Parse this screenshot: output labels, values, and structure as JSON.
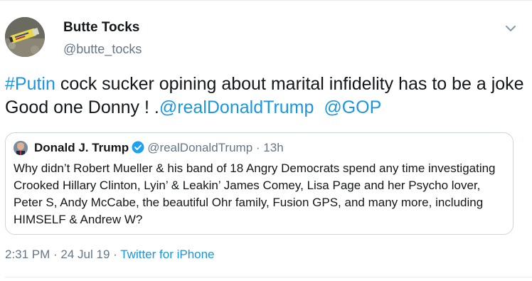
{
  "author": {
    "display_name": "Butte Tocks",
    "handle": "@butte_tocks"
  },
  "tweet": {
    "segments": [
      {
        "text": "#Putin",
        "link": true
      },
      {
        "text": " cock sucker opining about marital infidelity has to be a joke Good one Donny ! .",
        "link": false
      },
      {
        "text": "@realDonaldTrump",
        "link": true
      },
      {
        "text": "  ",
        "link": false
      },
      {
        "text": "@GOP",
        "link": true
      }
    ]
  },
  "quoted_tweet": {
    "name": "Donald J. Trump",
    "verified": true,
    "handle": "@realDonaldTrump",
    "separator": "·",
    "time": "13h",
    "text": "Why didn’t Robert Mueller & his band of 18 Angry Democrats spend any time investigating Crooked Hillary Clinton, Lyin’ & Leakin’ James Comey, Lisa Page and her Psycho lover, Peter S, Andy McCabe, the beautiful Ohr family, Fusion GPS, and many more,  including HIMSELF & Andrew W?"
  },
  "meta": {
    "time": "2:31 PM",
    "sep1": " · ",
    "date": "24 Jul 19",
    "sep2": " · ",
    "source": "Twitter for iPhone"
  },
  "colors": {
    "link": "#1b95e0",
    "secondary_text": "#657786",
    "border": "#ccd6dd"
  },
  "icons": {
    "menu": "chevron-down-icon",
    "verified": "verified-badge-icon"
  }
}
